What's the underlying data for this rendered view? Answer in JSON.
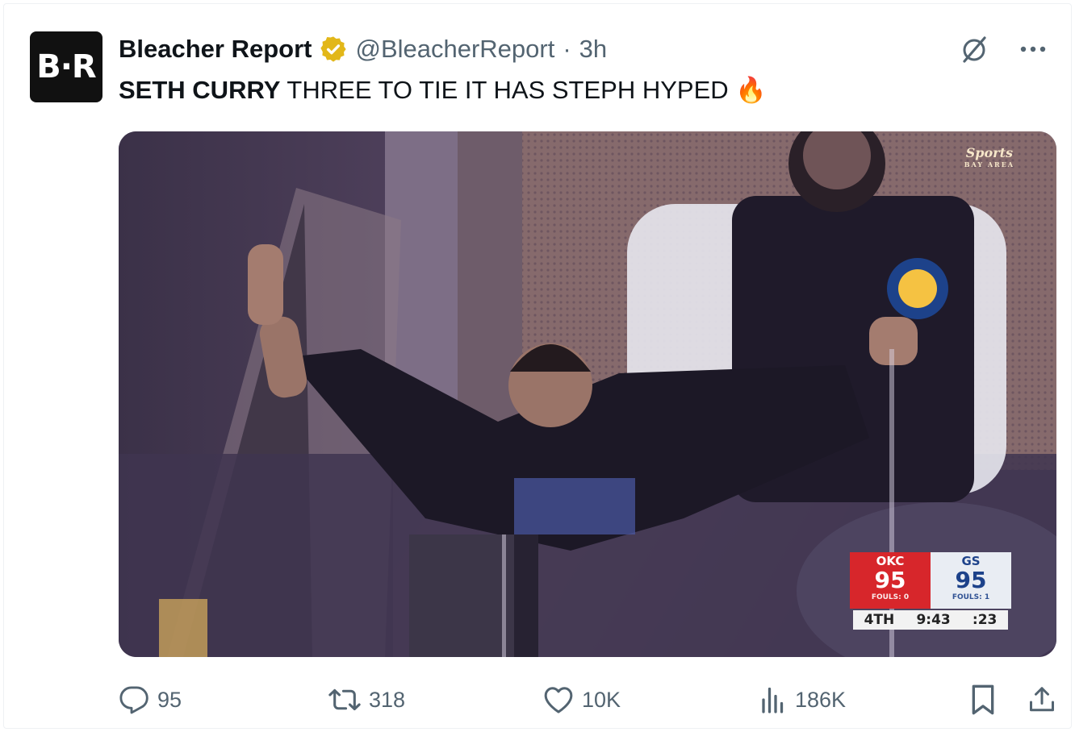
{
  "tweet": {
    "avatar_text": "B·R",
    "author_name": "Bleacher Report",
    "handle": "@BleacherReport",
    "separator": "·",
    "time_ago": "3h",
    "text_bold": "SETH CURRY",
    "text_rest": " THREE TO TIE IT HAS STEPH HYPED ",
    "emoji": "🔥"
  },
  "media": {
    "network_logo": "Sports",
    "network_sub": "BAY AREA",
    "scoreboard": {
      "home_abbr": "OKC",
      "home_score": "95",
      "home_fouls": "FOULS: 0",
      "away_abbr": "GS",
      "away_score": "95",
      "away_fouls": "FOULS: 1",
      "quarter": "4TH",
      "clock": "9:43",
      "shot_clock": ":23"
    }
  },
  "actions": {
    "replies": "95",
    "retweets": "318",
    "likes": "10K",
    "views": "186K"
  },
  "colors": {
    "verified_gold": "#e2b719",
    "okc_red": "#d7262b",
    "gs_blue": "#1d428a",
    "muted_text": "#536471"
  },
  "icons": [
    "grok-icon",
    "more-icon",
    "reply-icon",
    "retweet-icon",
    "like-icon",
    "views-icon",
    "bookmark-icon",
    "share-icon"
  ]
}
